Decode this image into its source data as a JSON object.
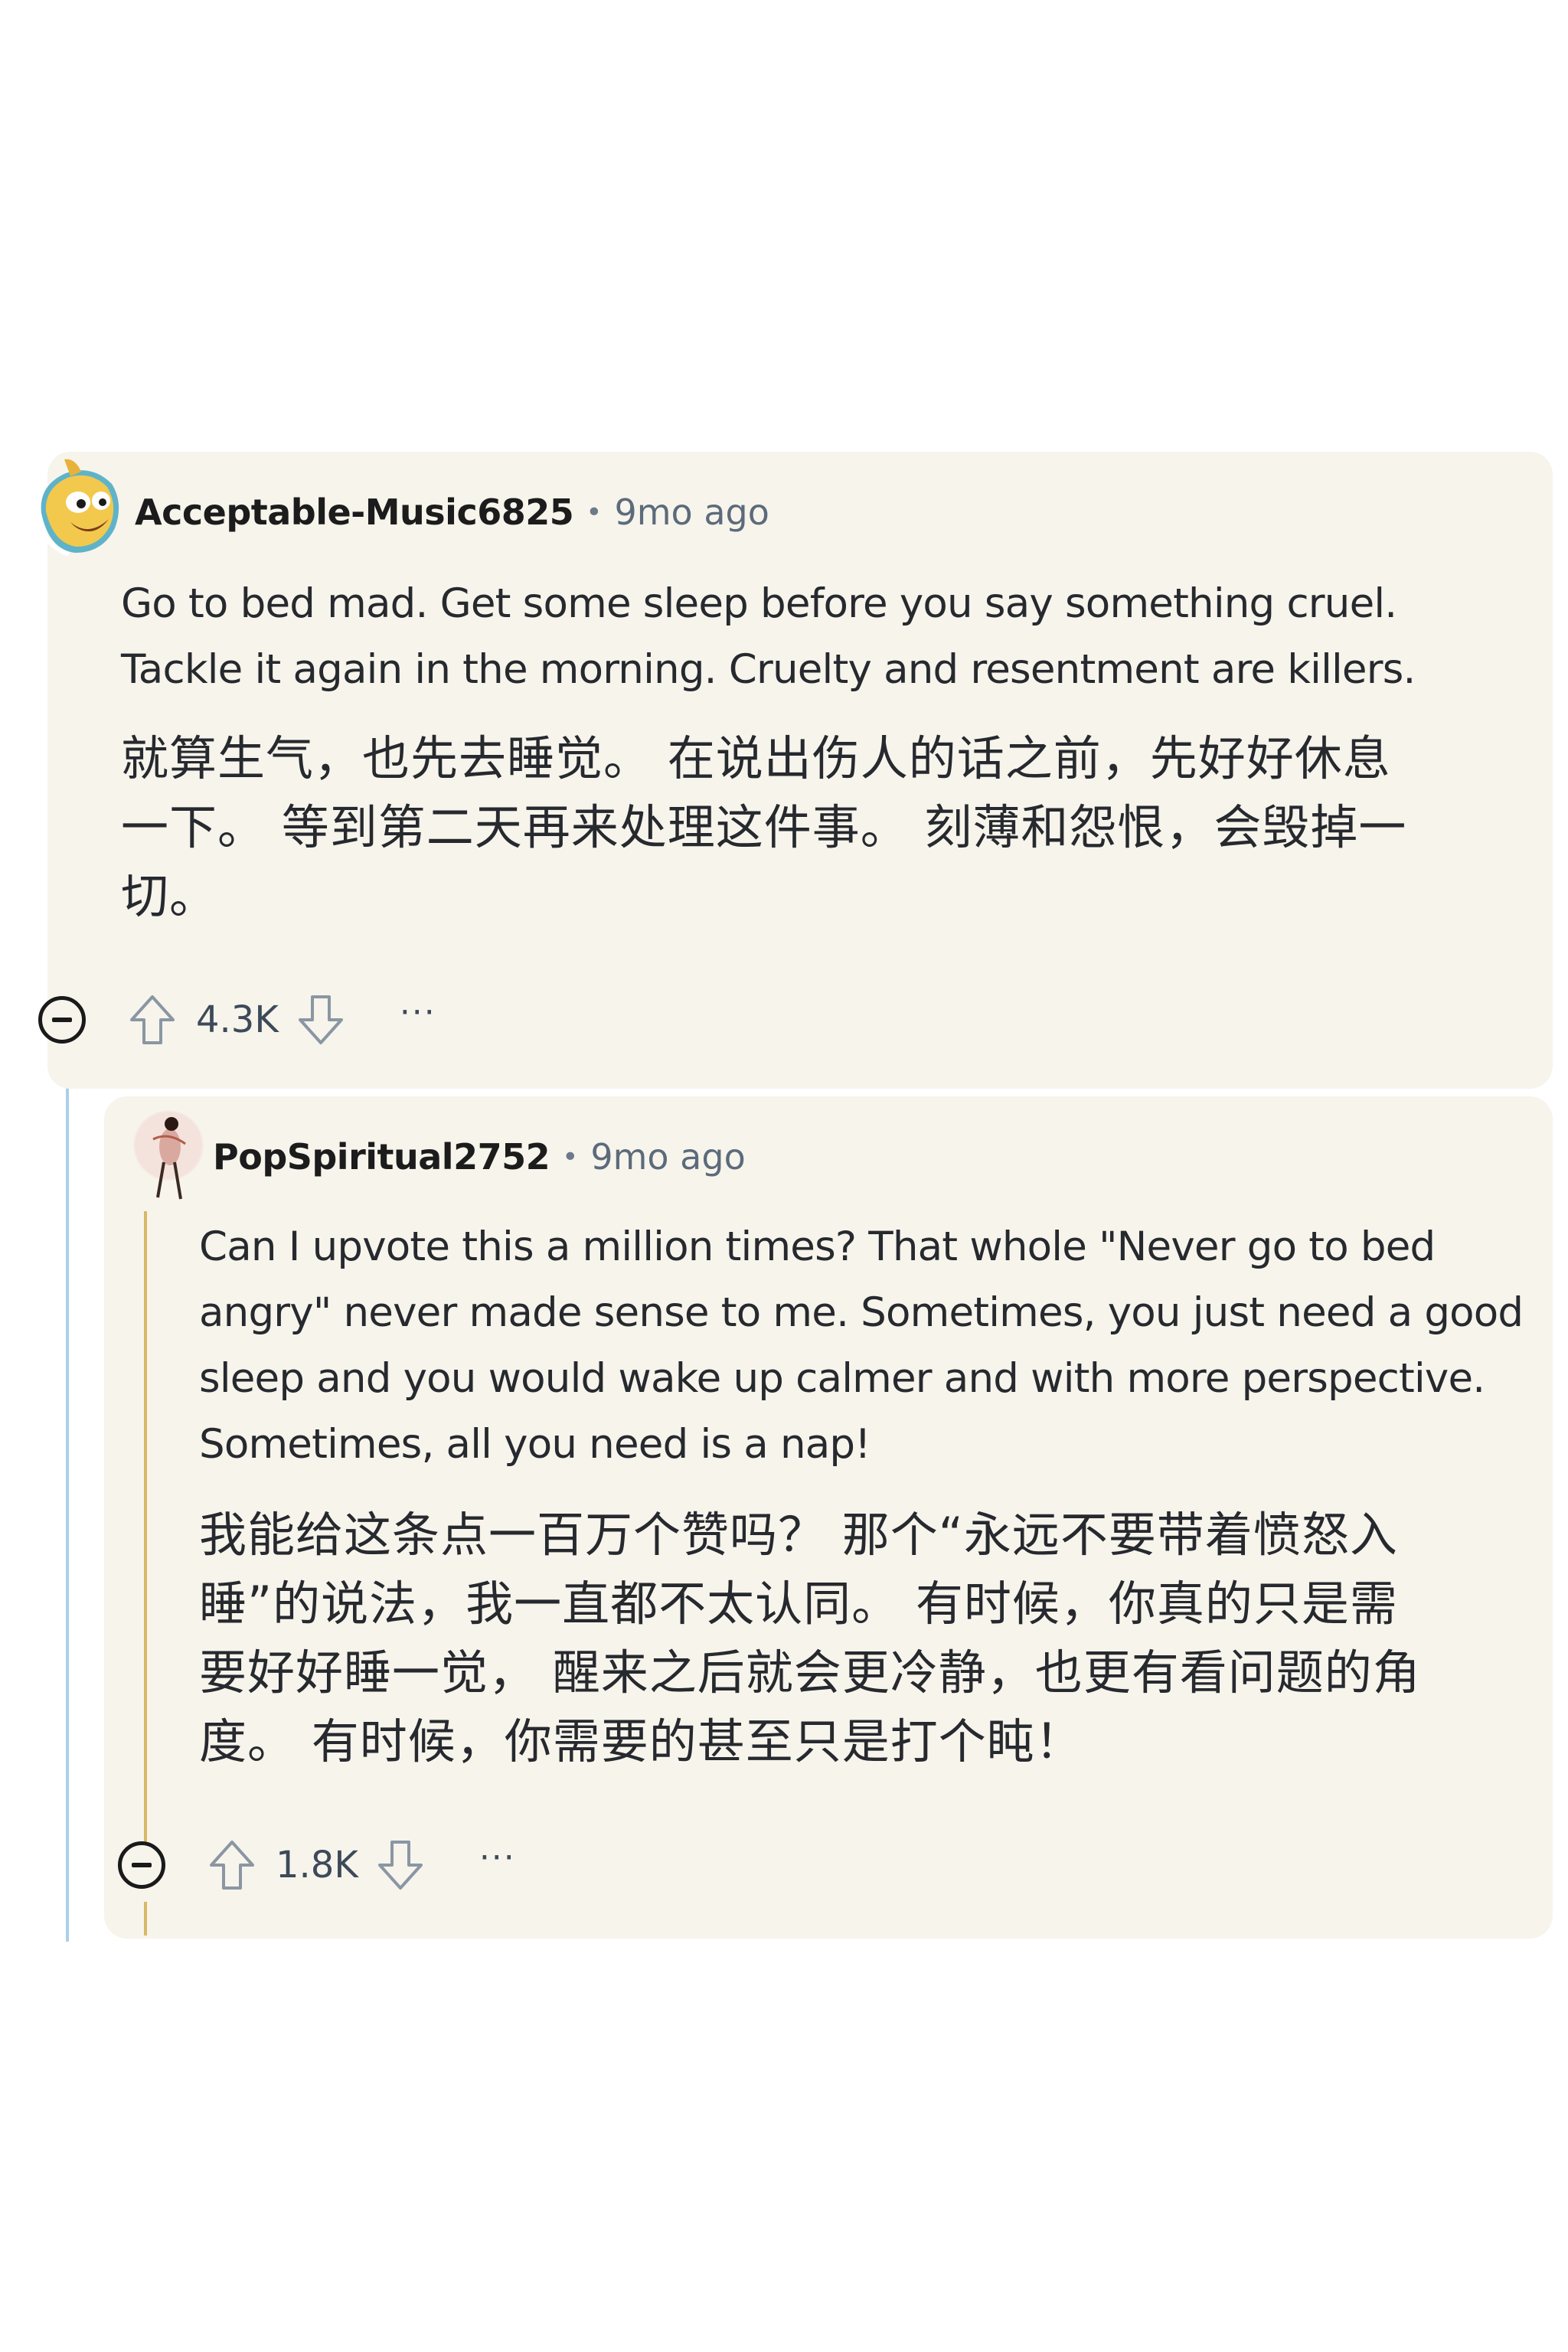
{
  "colors": {
    "card_bg": "#f7f4ec",
    "thread_line": "#d8b865",
    "thread_line_blue": "#a9d0ea",
    "username": "#1c1c1c",
    "meta": "#5c6b7a"
  },
  "comment": {
    "username": "Acceptable-Music6825",
    "separator": "•",
    "time": "9mo ago",
    "avatar_icon": "snoo-avatar-icon",
    "text_en": [
      "Go to bed mad. Get some sleep before you say something cruel.",
      "Tackle it again in the morning. Cruelty and resentment are killers."
    ],
    "text_zh": [
      "就算生气，也先去睡觉。 在说出伤人的话之前，先好好休息",
      "一下。 等到第二天再来处理这件事。 刻薄和怨恨，会毁掉一",
      "切。"
    ],
    "votes": "4.3K",
    "more": "···"
  },
  "reply": {
    "username": "PopSpiritual2752",
    "separator": "•",
    "time": "9mo ago",
    "avatar_icon": "user-avatar-icon",
    "text_en": [
      "Can I upvote this a million times? That whole \"Never go to bed",
      "angry\" never made sense to me. Sometimes, you just need a good",
      "sleep and you would wake up calmer and with more perspective.",
      "Sometimes, all you need is a nap!"
    ],
    "text_zh": [
      "我能给这条点一百万个赞吗？ 那个“永远不要带着愤怒入",
      "睡”的说法，我一直都不太认同。 有时候，你真的只是需",
      "要好好睡一觉， 醒来之后就会更冷静，也更有看问题的角",
      "度。 有时候，你需要的甚至只是打个盹！"
    ],
    "votes": "1.8K",
    "more": "···"
  }
}
